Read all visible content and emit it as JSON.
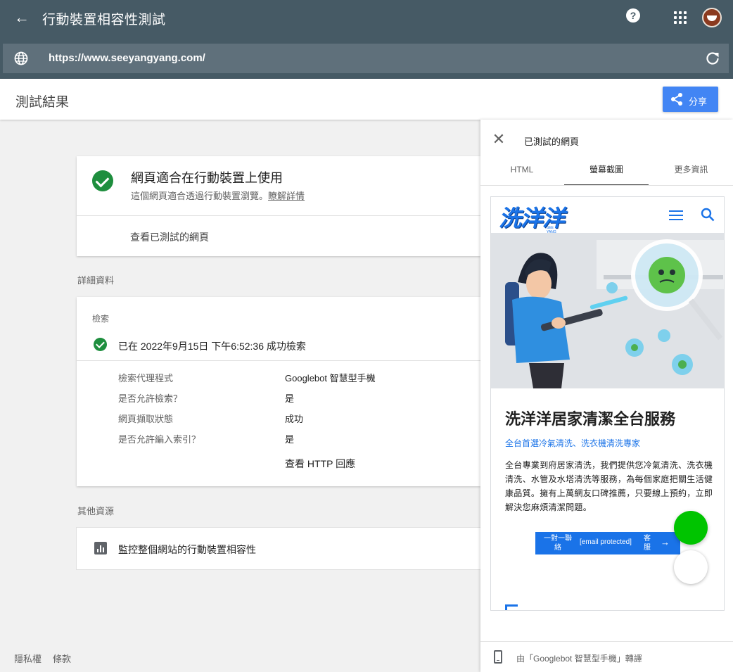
{
  "app": {
    "title": "行動裝置相容性測試",
    "url": "https://www.seeyangyang.com/"
  },
  "header": {
    "title": "測試結果",
    "share_label": "分享"
  },
  "result": {
    "title": "網頁適合在行動裝置上使用",
    "description": "這個網頁適合透過行動裝置瀏覽。",
    "learn_more": "瞭解詳情",
    "view_tested": "查看已測試的網頁"
  },
  "details": {
    "section_label": "詳細資料",
    "crawl_header": "檢索",
    "crawl_status": "已在 2022年9月15日 下午6:52:36 成功檢索",
    "rows": [
      {
        "label": "檢索代理程式",
        "value": "Googlebot 智慧型手機"
      },
      {
        "label": "是否允許檢索？",
        "value": "是"
      },
      {
        "label": "網頁擷取狀態",
        "value": "成功"
      },
      {
        "label": "是否允許編入索引？",
        "value": "是"
      }
    ],
    "http_link": "查看 HTTP 回應"
  },
  "other": {
    "section_label": "其他資源",
    "monitor": "監控整個網站的行動裝置相容性"
  },
  "footer": {
    "privacy": "隱私權",
    "terms": "條款"
  },
  "panel": {
    "title": "已測試的網頁",
    "tabs": [
      "HTML",
      "螢幕截圖",
      "更多資訊"
    ],
    "active_tab": "螢幕截圖",
    "rendered_by": "由「Googlebot 智慧型手機」轉譯"
  },
  "site": {
    "logo": "洗洋洋",
    "logo_sub": "SEE YANG YANG",
    "headline": "洗洋洋居家清潔全台服務",
    "subtitle": "全台首選冷氣清洗、洗衣機清洗專家",
    "body": "全台專業到府居家清洗，我們提供您冷氣清洗、洗衣機清洗、水管及水塔清洗等服務，為每個家庭把關生活健康品質。擁有上萬網友口碑推薦，只要線上預約，立即解決您麻煩清潔問題。",
    "cta_left": "一對一聯絡",
    "cta_mid": "[email protected]",
    "cta_right": "客服",
    "cta_arrow": "→"
  },
  "colors": {
    "topbar": "#465a65",
    "accent": "#4285f4",
    "success": "#1e8e3e",
    "site_blue": "#1a73e8",
    "fab_green": "#00c400"
  }
}
